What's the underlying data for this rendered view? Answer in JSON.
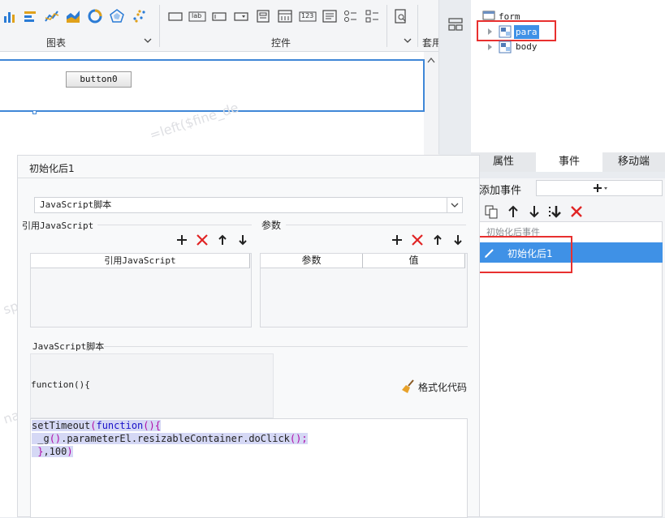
{
  "ribbon": {
    "chart_group_label": "图表",
    "widget_group_label": "控件",
    "apply_group_label": "套用",
    "widget_icon_labels": [
      "lab",
      "123"
    ]
  },
  "canvas": {
    "button_label": "button0",
    "watermark_1": "=left($fine_de",
    "watermark_2": "sp",
    "watermark_3": "na"
  },
  "tree": {
    "nodes": [
      {
        "label": "form"
      },
      {
        "label": "para",
        "selected": true
      },
      {
        "label": "body"
      }
    ]
  },
  "tabs": [
    {
      "label": "属性",
      "active": false
    },
    {
      "label": "事件",
      "active": true
    },
    {
      "label": "移动端",
      "active": false
    }
  ],
  "events": {
    "add_event_label": "添加事件",
    "category_label": "初始化后事件",
    "item_label": "初始化后1"
  },
  "dialog": {
    "title": "初始化后1",
    "type_select_value": "JavaScript脚本",
    "ref_js_section": "引用JavaScript",
    "ref_js_column": "引用JavaScript",
    "params_section": "参数",
    "params_columns": [
      "参数",
      "值"
    ],
    "script_section": "JavaScript脚本",
    "function_header": "function(){",
    "format_code_label": "格式化代码",
    "code": {
      "line1_a": "setTimeout",
      "line1_b": "(",
      "line1_c": "function",
      "line1_d": "(){",
      "line2_a": " _g",
      "line2_b": "()",
      "line2_c": ".parameterEl.resizableContainer.doClick",
      "line2_d": "();",
      "line3_a": " }",
      "line3_b": ",100",
      "line3_c": ")"
    }
  },
  "colors": {
    "accent_blue": "#3f87d7",
    "selection_blue": "#3f91e6",
    "red_highlight": "#e8302f",
    "delete_red": "#e02424"
  }
}
